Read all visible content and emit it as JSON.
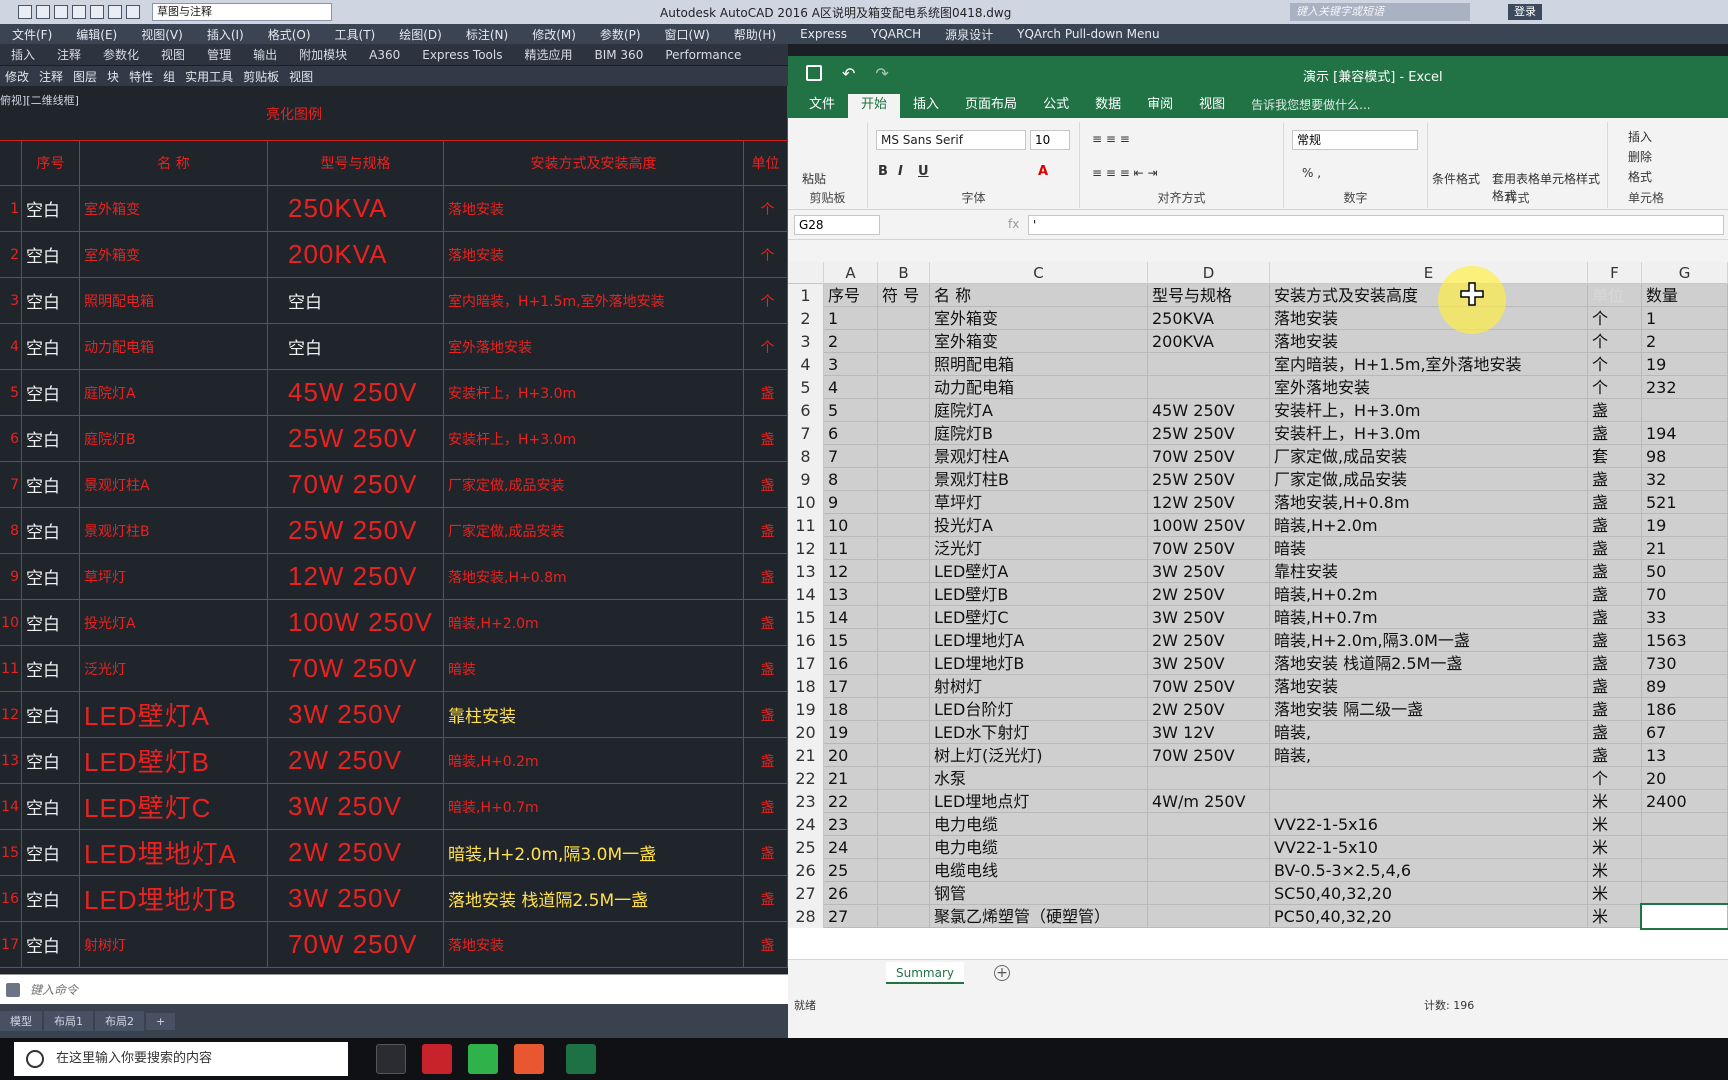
{
  "autocad": {
    "workspace": "草图与注释",
    "title": "Autodesk AutoCAD 2016     A区说明及箱变配电系统图0418.dwg",
    "search_placeholder": "键入关键字或短语",
    "login": "登录",
    "menu": [
      "文件(F)",
      "编辑(E)",
      "视图(V)",
      "插入(I)",
      "格式(O)",
      "工具(T)",
      "绘图(D)",
      "标注(N)",
      "修改(M)",
      "参数(P)",
      "窗口(W)",
      "帮助(H)",
      "Express",
      "YQARCH",
      "源泉设计",
      "YQArch Pull-down Menu"
    ],
    "ribbon_tabs": [
      "插入",
      "注释",
      "参数化",
      "视图",
      "管理",
      "输出",
      "附加模块",
      "A360",
      "Express Tools",
      "精选应用",
      "BIM 360",
      "Performance"
    ],
    "ribbon_panels": [
      "修改",
      "注释",
      "图层",
      "块",
      "特性",
      "组",
      "实用工具",
      "剪贴板",
      "视图"
    ],
    "viewport_label": "俯视][二维线框]",
    "table_title": "亮化图例",
    "headers": [
      "序号",
      "符 号",
      "名 称",
      "型号与规格",
      "安装方式及安装高度",
      "单位"
    ],
    "rows": [
      {
        "idx": "1",
        "sym": "空白",
        "name": "室外箱变",
        "spec": "250KVA",
        "mount": "落地安装",
        "mount_color": "red",
        "unit": "个"
      },
      {
        "idx": "2",
        "sym": "空白",
        "name": "室外箱变",
        "spec": "200KVA",
        "mount": "落地安装",
        "mount_color": "red",
        "unit": "个"
      },
      {
        "idx": "3",
        "sym": "空白",
        "name": "照明配电箱",
        "spec": "空白",
        "mount": "室内暗装，H+1.5m,室外落地安装",
        "mount_color": "red",
        "unit": "个"
      },
      {
        "idx": "4",
        "sym": "空白",
        "name": "动力配电箱",
        "spec": "空白",
        "mount": "室外落地安装",
        "mount_color": "red",
        "unit": "个"
      },
      {
        "idx": "5",
        "sym": "空白",
        "name": "庭院灯A",
        "spec": "45W 250V",
        "mount": "安装杆上，H+3.0m",
        "mount_color": "red",
        "unit": "盏"
      },
      {
        "idx": "6",
        "sym": "空白",
        "name": "庭院灯B",
        "spec": "25W 250V",
        "mount": "安装杆上，H+3.0m",
        "mount_color": "red",
        "unit": "盏"
      },
      {
        "idx": "7",
        "sym": "空白",
        "name": "景观灯柱A",
        "spec": "70W 250V",
        "mount": "厂家定做,成品安装",
        "mount_color": "red",
        "unit": "盏"
      },
      {
        "idx": "8",
        "sym": "空白",
        "name": "景观灯柱B",
        "spec": "25W 250V",
        "mount": "厂家定做,成品安装",
        "mount_color": "red",
        "unit": "盏"
      },
      {
        "idx": "9",
        "sym": "空白",
        "name": "草坪灯",
        "spec": "12W 250V",
        "mount": "落地安装,H+0.8m",
        "mount_color": "red",
        "unit": "盏"
      },
      {
        "idx": "10",
        "sym": "空白",
        "name": "投光灯A",
        "spec": "100W 250V",
        "mount": "暗装,H+2.0m",
        "mount_color": "red",
        "unit": "盏"
      },
      {
        "idx": "11",
        "sym": "空白",
        "name": "泛光灯",
        "spec": "70W 250V",
        "mount": "暗装",
        "mount_color": "red",
        "unit": "盏"
      },
      {
        "idx": "12",
        "sym": "空白",
        "name": "LED壁灯A",
        "spec": "3W 250V",
        "mount": "靠柱安装",
        "mount_color": "yellow",
        "unit": "盏"
      },
      {
        "idx": "13",
        "sym": "空白",
        "name": "LED壁灯B",
        "spec": "2W 250V",
        "mount": "暗装,H+0.2m",
        "mount_color": "red",
        "unit": "盏"
      },
      {
        "idx": "14",
        "sym": "空白",
        "name": "LED壁灯C",
        "spec": "3W 250V",
        "mount": "暗装,H+0.7m",
        "mount_color": "red",
        "unit": "盏"
      },
      {
        "idx": "15",
        "sym": "空白",
        "name": "LED埋地灯A",
        "spec": "2W 250V",
        "mount": "暗装,H+2.0m,隔3.0M一盏",
        "mount_color": "yellow",
        "unit": "盏"
      },
      {
        "idx": "16",
        "sym": "空白",
        "name": "LED埋地灯B",
        "spec": "3W 250V",
        "mount": "落地安装 栈道隔2.5M一盏",
        "mount_color": "yellow",
        "unit": "盏"
      },
      {
        "idx": "17",
        "sym": "空白",
        "name": "射树灯",
        "spec": "70W 250V",
        "mount": "落地安装",
        "mount_color": "red",
        "unit": "盏"
      }
    ],
    "command_placeholder": "键入命令",
    "layout_tabs": [
      "模型",
      "布局1",
      "布局2",
      "+"
    ]
  },
  "excel": {
    "title": "演示 [兼容模式] - Excel",
    "tabs": [
      "文件",
      "开始",
      "插入",
      "页面布局",
      "公式",
      "数据",
      "审阅",
      "视图"
    ],
    "tell_me": "告诉我您想要做什么...",
    "font": "MS Sans Serif",
    "font_size": "10",
    "number_format": "常规",
    "group_labels": [
      "剪贴板",
      "字体",
      "对齐方式",
      "数字",
      "样式",
      "单元格"
    ],
    "buttons": {
      "paste": "粘贴",
      "cond": "条件格式",
      "table": "套用表格格式",
      "cellstyle": "单元格样式",
      "insert": "插入",
      "delete": "删除",
      "format": "格式"
    },
    "name_box": "G28",
    "formula": "'",
    "col_headers": [
      "A",
      "B",
      "C",
      "D",
      "E",
      "F",
      "G"
    ],
    "rows": [
      [
        "1",
        "序号",
        "符 号",
        "名 称",
        "型号与规格",
        "安装方式及安装高度",
        "单位",
        "数量"
      ],
      [
        "2",
        "1",
        "",
        "室外箱变",
        "250KVA",
        "落地安装",
        "个",
        "1"
      ],
      [
        "3",
        "2",
        "",
        "室外箱变",
        "200KVA",
        "落地安装",
        "个",
        "2"
      ],
      [
        "4",
        "3",
        "",
        "照明配电箱",
        "",
        "室内暗装，H+1.5m,室外落地安装",
        "个",
        "19"
      ],
      [
        "5",
        "4",
        "",
        "动力配电箱",
        "",
        "室外落地安装",
        "个",
        "232"
      ],
      [
        "6",
        "5",
        "",
        "庭院灯A",
        "45W  250V",
        "安装杆上，H+3.0m",
        "盏",
        ""
      ],
      [
        "7",
        "6",
        "",
        "庭院灯B",
        "25W  250V",
        "安装杆上，H+3.0m",
        "盏",
        "194"
      ],
      [
        "8",
        "7",
        "",
        "景观灯柱A",
        "70W  250V",
        "厂家定做,成品安装",
        "套",
        "98"
      ],
      [
        "9",
        "8",
        "",
        "景观灯柱B",
        "25W  250V",
        "厂家定做,成品安装",
        "盏",
        "32"
      ],
      [
        "10",
        "9",
        "",
        "草坪灯",
        "12W  250V",
        "落地安装,H+0.8m",
        "盏",
        "521"
      ],
      [
        "11",
        "10",
        "",
        "投光灯A",
        "100W  250V",
        "暗装,H+2.0m",
        "盏",
        "19"
      ],
      [
        "12",
        "11",
        "",
        "泛光灯",
        "70W  250V",
        "暗装",
        "盏",
        "21"
      ],
      [
        "13",
        "12",
        "",
        "LED壁灯A",
        "3W  250V",
        "靠柱安装",
        "盏",
        "50"
      ],
      [
        "14",
        "13",
        "",
        "LED壁灯B",
        "2W  250V",
        "暗装,H+0.2m",
        "盏",
        "70"
      ],
      [
        "15",
        "14",
        "",
        "LED壁灯C",
        "3W  250V",
        "暗装,H+0.7m",
        "盏",
        "33"
      ],
      [
        "16",
        "15",
        "",
        "LED埋地灯A",
        "2W  250V",
        "暗装,H+2.0m,隔3.0M一盏",
        "盏",
        "1563"
      ],
      [
        "17",
        "16",
        "",
        "LED埋地灯B",
        "3W  250V",
        "落地安装 栈道隔2.5M一盏",
        "盏",
        "730"
      ],
      [
        "18",
        "17",
        "",
        "射树灯",
        "70W  250V",
        "落地安装",
        "盏",
        "89"
      ],
      [
        "19",
        "18",
        "",
        "LED台阶灯",
        "2W  250V",
        "落地安装 隔二级一盏",
        "盏",
        "186"
      ],
      [
        "20",
        "19",
        "",
        "LED水下射灯",
        "3W  12V",
        "暗装,",
        "盏",
        "67"
      ],
      [
        "21",
        "20",
        "",
        "树上灯(泛光灯)",
        "70W  250V",
        "暗装,",
        "盏",
        "13"
      ],
      [
        "22",
        "21",
        "",
        "水泵",
        "",
        "",
        "个",
        "20"
      ],
      [
        "23",
        "22",
        "",
        "LED埋地点灯",
        "4W/m  250V",
        "",
        "米",
        "2400"
      ],
      [
        "24",
        "23",
        "",
        "电力电缆",
        "",
        "VV22-1-5x16",
        "米",
        ""
      ],
      [
        "25",
        "24",
        "",
        "电力电缆",
        "",
        "VV22-1-5x10",
        "米",
        ""
      ],
      [
        "26",
        "25",
        "",
        "电缆电线",
        "",
        "BV-0.5-3×2.5,4,6",
        "米",
        ""
      ],
      [
        "27",
        "26",
        "",
        "钢管",
        "",
        "SC50,40,32,20",
        "米",
        ""
      ],
      [
        "28",
        "27",
        "",
        "聚氯乙烯塑管（硬塑管）",
        "",
        "PC50,40,32,20",
        "米",
        ""
      ]
    ],
    "sheet_tab": "Summary",
    "status_ready": "就绪",
    "status_count": "计数: 196"
  },
  "taskbar": {
    "search_placeholder": "在这里输入你要搜索的内容"
  },
  "colors": {
    "excel_green": "#217346",
    "cad_red": "#e8231f",
    "cad_yellow": "#ffe04d"
  }
}
